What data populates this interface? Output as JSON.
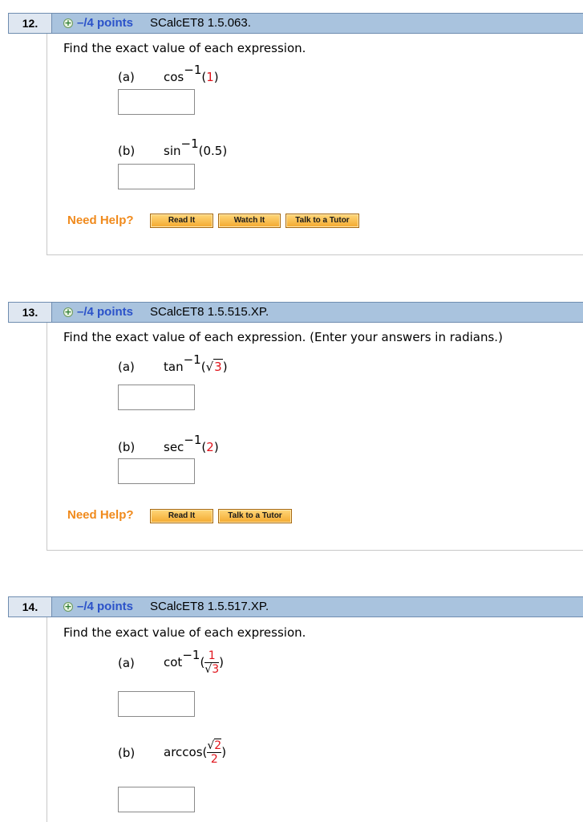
{
  "questions": [
    {
      "number": "12.",
      "points": "–/4 points",
      "source": "SCalcET8 1.5.063.",
      "prompt": "Find the exact value of each expression.",
      "parts": [
        {
          "label": "(a)",
          "fn": "cos",
          "exp": "−1",
          "arg": "1"
        },
        {
          "label": "(b)",
          "fn": "sin",
          "exp": "−1",
          "arg": "0.5"
        }
      ],
      "need_help": "Need Help?",
      "help_buttons": [
        "Read It",
        "Watch It",
        "Talk to a Tutor"
      ]
    },
    {
      "number": "13.",
      "points": "–/4 points",
      "source": "SCalcET8 1.5.515.XP.",
      "prompt": "Find the exact value of each expression. (Enter your answers in radians.)",
      "parts": [
        {
          "label": "(a)",
          "fn": "tan",
          "exp": "−1",
          "arg": "3"
        },
        {
          "label": "(b)",
          "fn": "sec",
          "exp": "−1",
          "arg": "2"
        }
      ],
      "need_help": "Need Help?",
      "help_buttons": [
        "Read It",
        "Talk to a Tutor"
      ]
    },
    {
      "number": "14.",
      "points": "–/4 points",
      "source": "SCalcET8 1.5.517.XP.",
      "prompt": "Find the exact value of each expression.",
      "parts": [
        {
          "label": "(a)",
          "fn": "cot",
          "exp": "−1",
          "num": "1",
          "den": "3"
        },
        {
          "label": "(b)",
          "fn": "arccos",
          "num": "2",
          "den": "2"
        }
      ]
    }
  ],
  "colors": {
    "header_bg": "#a9c3de",
    "points": "#2b52c9",
    "need_help": "#f08a1c",
    "value": "#e0141c"
  }
}
